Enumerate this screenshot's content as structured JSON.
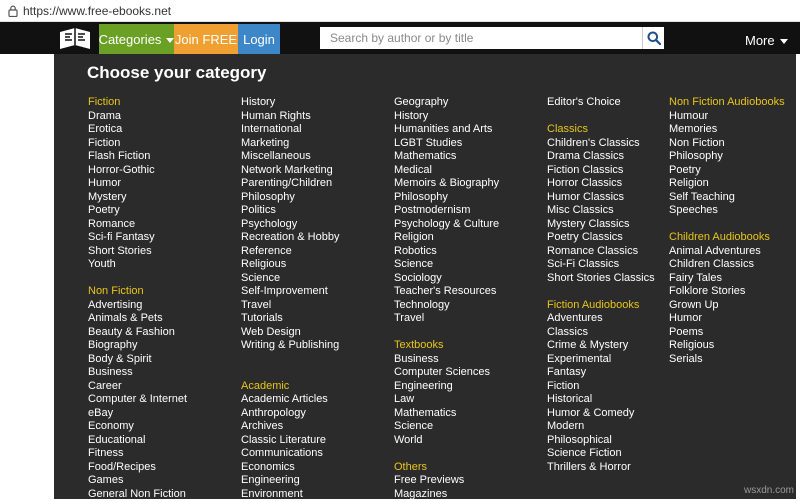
{
  "browser": {
    "url": "https://www.free-ebooks.net"
  },
  "nav": {
    "categories_label": "Categories",
    "join_label": "Join FREE",
    "login_label": "Login",
    "search_placeholder": "Search by author or by title",
    "more_label": "More"
  },
  "panel": {
    "title": "Choose your category",
    "columns": [
      [
        {
          "t": "Fiction",
          "h": true
        },
        {
          "t": "Drama"
        },
        {
          "t": "Erotica"
        },
        {
          "t": "Fiction"
        },
        {
          "t": "Flash Fiction"
        },
        {
          "t": "Horror-Gothic"
        },
        {
          "t": "Humor"
        },
        {
          "t": "Mystery"
        },
        {
          "t": "Poetry"
        },
        {
          "t": "Romance"
        },
        {
          "t": "Sci-fi Fantasy"
        },
        {
          "t": "Short Stories"
        },
        {
          "t": "Youth"
        },
        {
          "gap": true
        },
        {
          "t": "Non Fiction",
          "h": true
        },
        {
          "t": "Advertising"
        },
        {
          "t": "Animals & Pets"
        },
        {
          "t": "Beauty & Fashion"
        },
        {
          "t": "Biography"
        },
        {
          "t": "Body & Spirit"
        },
        {
          "t": "Business"
        },
        {
          "t": "Career"
        },
        {
          "t": "Computer & Internet"
        },
        {
          "t": "eBay"
        },
        {
          "t": "Economy"
        },
        {
          "t": "Educational"
        },
        {
          "t": "Fitness"
        },
        {
          "t": "Food/Recipes"
        },
        {
          "t": "Games"
        },
        {
          "t": "General Non Fiction"
        }
      ],
      [
        {
          "t": "History"
        },
        {
          "t": "Human Rights"
        },
        {
          "t": "International"
        },
        {
          "t": "Marketing"
        },
        {
          "t": "Miscellaneous"
        },
        {
          "t": "Network Marketing"
        },
        {
          "t": "Parenting/Children"
        },
        {
          "t": "Philosophy"
        },
        {
          "t": "Politics"
        },
        {
          "t": "Psychology"
        },
        {
          "t": "Recreation & Hobby"
        },
        {
          "t": "Reference"
        },
        {
          "t": "Religious"
        },
        {
          "t": "Science"
        },
        {
          "t": "Self-Improvement"
        },
        {
          "t": "Travel"
        },
        {
          "t": "Tutorials"
        },
        {
          "t": "Web Design"
        },
        {
          "t": "Writing & Publishing"
        },
        {
          "gap": true
        },
        {
          "gap": true
        },
        {
          "t": "Academic",
          "h": true
        },
        {
          "t": "Academic Articles"
        },
        {
          "t": "Anthropology"
        },
        {
          "t": "Archives"
        },
        {
          "t": "Classic Literature"
        },
        {
          "t": "Communications"
        },
        {
          "t": "Economics"
        },
        {
          "t": "Engineering"
        },
        {
          "t": "Environment"
        }
      ],
      [
        {
          "t": "Geography"
        },
        {
          "t": "History"
        },
        {
          "t": "Humanities and Arts"
        },
        {
          "t": "LGBT Studies"
        },
        {
          "t": "Mathematics"
        },
        {
          "t": "Medical"
        },
        {
          "t": "Memoirs & Biography"
        },
        {
          "t": "Philosophy"
        },
        {
          "t": "Postmodernism"
        },
        {
          "t": "Psychology & Culture"
        },
        {
          "t": "Religion"
        },
        {
          "t": "Robotics"
        },
        {
          "t": "Science"
        },
        {
          "t": "Sociology"
        },
        {
          "t": "Teacher's Resources"
        },
        {
          "t": "Technology"
        },
        {
          "t": "Travel"
        },
        {
          "gap": true
        },
        {
          "t": "Textbooks",
          "h": true
        },
        {
          "t": "Business"
        },
        {
          "t": "Computer Sciences"
        },
        {
          "t": "Engineering"
        },
        {
          "t": "Law"
        },
        {
          "t": "Mathematics"
        },
        {
          "t": "Science"
        },
        {
          "t": "World"
        },
        {
          "gap": true
        },
        {
          "t": "Others",
          "h": true
        },
        {
          "t": "Free Previews"
        },
        {
          "t": "Magazines"
        }
      ],
      [
        {
          "t": "Editor's Choice"
        },
        {
          "gap": true
        },
        {
          "t": "Classics",
          "h": true
        },
        {
          "t": "Children's Classics"
        },
        {
          "t": "Drama Classics"
        },
        {
          "t": "Fiction Classics"
        },
        {
          "t": "Horror Classics"
        },
        {
          "t": "Humor Classics"
        },
        {
          "t": "Misc Classics"
        },
        {
          "t": "Mystery Classics"
        },
        {
          "t": "Poetry Classics"
        },
        {
          "t": "Romance Classics"
        },
        {
          "t": "Sci-Fi Classics"
        },
        {
          "t": "Short Stories Classics"
        },
        {
          "gap": true
        },
        {
          "t": "Fiction Audiobooks",
          "h": true
        },
        {
          "t": "Adventures"
        },
        {
          "t": "Classics"
        },
        {
          "t": "Crime & Mystery"
        },
        {
          "t": "Experimental"
        },
        {
          "t": "Fantasy"
        },
        {
          "t": "Fiction"
        },
        {
          "t": "Historical"
        },
        {
          "t": "Humor & Comedy"
        },
        {
          "t": "Modern"
        },
        {
          "t": "Philosophical"
        },
        {
          "t": "Science Fiction"
        },
        {
          "t": "Thrillers & Horror"
        }
      ],
      [
        {
          "t": "Non Fiction Audiobooks",
          "h": true
        },
        {
          "t": "Humour"
        },
        {
          "t": "Memories"
        },
        {
          "t": "Non Fiction"
        },
        {
          "t": "Philosophy"
        },
        {
          "t": "Poetry"
        },
        {
          "t": "Religion"
        },
        {
          "t": "Self Teaching"
        },
        {
          "t": "Speeches"
        },
        {
          "gap": true
        },
        {
          "t": "Children Audiobooks",
          "h": true
        },
        {
          "t": "Animal Adventures"
        },
        {
          "t": "Children Classics"
        },
        {
          "t": "Fairy Tales"
        },
        {
          "t": "Folklore Stories"
        },
        {
          "t": "Grown Up"
        },
        {
          "t": "Humor"
        },
        {
          "t": "Poems"
        },
        {
          "t": "Religious"
        },
        {
          "t": "Serials"
        }
      ]
    ]
  },
  "watermark": "wsxdn.com",
  "colors": {
    "accent_heading": "#e8c51b",
    "categories_btn": "#6aa125",
    "join_btn": "#f0a030",
    "login_btn": "#3d87c9",
    "panel_bg": "#2b2b2b",
    "navbar_bg": "#111111"
  }
}
